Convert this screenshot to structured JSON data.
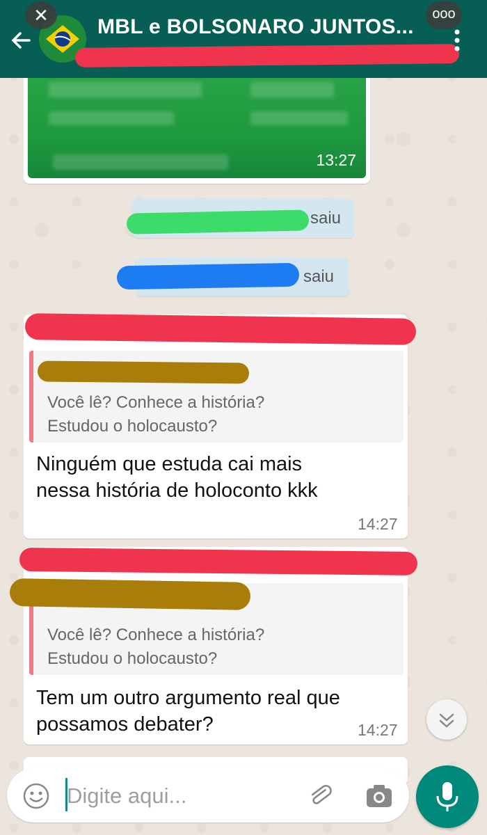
{
  "header": {
    "title": "MBL e BOLSONARO JUNTOS...",
    "close_glyph": "✕",
    "more_glyph": "ooo"
  },
  "messages": {
    "image_time": "13:27",
    "system": [
      {
        "text": "saiu"
      },
      {
        "text": "saiu"
      }
    ],
    "replies": [
      {
        "quote_line1": "Você lê?  Conhece a história?",
        "quote_line2": "Estudou o holocausto?",
        "text_line1": "Ninguém que estuda cai mais",
        "text_line2": "nessa história de holoconto kkk",
        "time": "14:27"
      },
      {
        "quote_line1": "Você lê?  Conhece a história?",
        "quote_line2": "Estudou o holocausto?",
        "text_line1": "Tem um outro argumento real que",
        "text_line2": "possamos debater?",
        "time": "14:27"
      }
    ]
  },
  "input": {
    "placeholder": "Digite aqui..."
  },
  "colors": {
    "header": "#075e54",
    "accent": "#00897b",
    "quote_bar": "#f07a86",
    "redact_red": "#f0344e",
    "redact_green": "#3ddc6a",
    "redact_blue": "#1e7cf2",
    "redact_gold": "#a87d0a"
  },
  "icons": [
    "back-arrow-icon",
    "menu-dots-icon",
    "emoji-icon",
    "paperclip-icon",
    "camera-icon",
    "microphone-icon",
    "chevron-down-icon"
  ]
}
